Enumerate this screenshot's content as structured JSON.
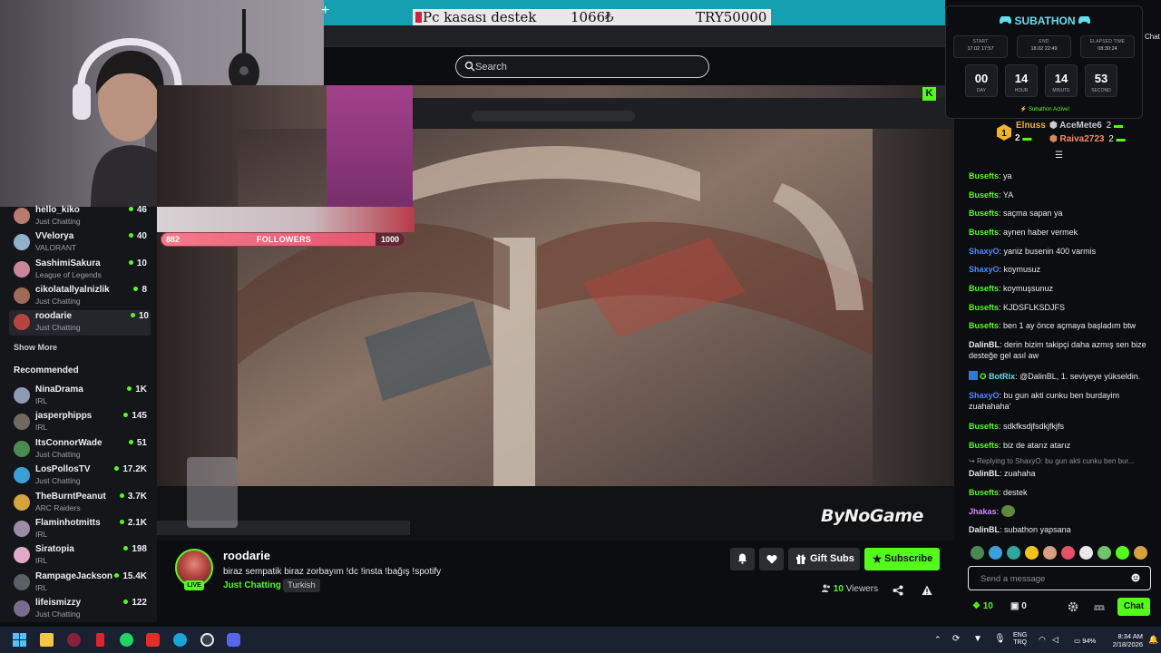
{
  "overlay_banner": {
    "title": "Pc kasası destek",
    "amount": "1066₺",
    "target": "TRY50000"
  },
  "search": {
    "placeholder": "Search"
  },
  "followers_goal": {
    "label": "FOLLOWERS",
    "current": "882",
    "goal": "1000",
    "progress": 0.882
  },
  "sidebar": {
    "following": [
      {
        "name": "hello_kiko",
        "category": "Just Chatting",
        "viewers": "46",
        "avatar_color": "#b87b6e"
      },
      {
        "name": "VVelorya",
        "category": "VALORANT",
        "viewers": "40",
        "avatar_color": "#8fb1c9"
      },
      {
        "name": "SashimiSakura",
        "category": "League of Legends",
        "viewers": "10",
        "avatar_color": "#c9869b"
      },
      {
        "name": "cikolatallyalnizlik",
        "category": "Just Chatting",
        "viewers": "8",
        "avatar_color": "#a06a58"
      },
      {
        "name": "roodarie",
        "category": "Just Chatting",
        "viewers": "10",
        "avatar_color": "#b5443f"
      }
    ],
    "show_more": "Show More",
    "recommended_heading": "Recommended",
    "recommended": [
      {
        "name": "NinaDrama",
        "category": "IRL",
        "viewers": "1K",
        "avatar_color": "#8d9ab5"
      },
      {
        "name": "jasperphipps",
        "category": "IRL",
        "viewers": "145",
        "avatar_color": "#6f6a60"
      },
      {
        "name": "ItsConnorWade",
        "category": "Just Chatting",
        "viewers": "51",
        "avatar_color": "#4a8b52"
      },
      {
        "name": "LosPollosTV",
        "category": "Just Chatting",
        "viewers": "17.2K",
        "avatar_color": "#3aa0d8"
      },
      {
        "name": "TheBurntPeanut",
        "category": "ARC Raiders",
        "viewers": "3.7K",
        "avatar_color": "#d6a43a"
      },
      {
        "name": "Flaminhotmitts",
        "category": "IRL",
        "viewers": "2.1K",
        "avatar_color": "#9d8ca6"
      },
      {
        "name": "Siratopia",
        "category": "IRL",
        "viewers": "198",
        "avatar_color": "#e0a9c8"
      },
      {
        "name": "RampageJackson",
        "category": "IRL",
        "viewers": "15.4K",
        "avatar_color": "#5b5f68"
      },
      {
        "name": "lifeismizzy",
        "category": "Just Chatting",
        "viewers": "122",
        "avatar_color": "#7a6b8d"
      }
    ]
  },
  "stream": {
    "streamer_name": "roodarie",
    "live_label": "LIVE",
    "title": "biraz sempatik biraz zorbayım !dc !insta !bağış !spotify",
    "category": "Just Chatting",
    "language": "Turkish",
    "viewers_number": "10",
    "viewers_label": "Viewers",
    "gift_subs_label": "Gift Subs",
    "subscribe_label": "Subscribe",
    "watermark": "ByNoGame"
  },
  "subathon": {
    "title": "SUBATHON",
    "start_label": "START",
    "start_value": "17.02 17:57",
    "end_label": "END",
    "end_value": "18.02 22:49",
    "elapsed_label": "ELAPSED TIME",
    "elapsed_value": "08:30:24",
    "countdown": [
      {
        "value": "00",
        "unit": "DAY"
      },
      {
        "value": "14",
        "unit": "HOUR"
      },
      {
        "value": "14",
        "unit": "MINUTE"
      },
      {
        "value": "53",
        "unit": "SECOND"
      }
    ],
    "status": "Subathon Active!",
    "chat_tab": "Chat"
  },
  "gifters": {
    "first": {
      "name": "Elnuss",
      "count": "2"
    },
    "second": {
      "name": "AceMete6",
      "count": "2"
    },
    "third": {
      "name": "Raiva2723",
      "count": "2"
    }
  },
  "chat": {
    "messages": [
      {
        "user": "Busefts",
        "user_color": "#53fc18",
        "text": "ya"
      },
      {
        "user": "Busefts",
        "user_color": "#53fc18",
        "text": "YA"
      },
      {
        "user": "Busefts",
        "user_color": "#53fc18",
        "text": "saçma sapan ya"
      },
      {
        "user": "Busefts",
        "user_color": "#53fc18",
        "text": "aynen haber vermek"
      },
      {
        "user": "ShaxyO",
        "user_color": "#4a8cff",
        "text": "yaniz busenin 400 varmis"
      },
      {
        "user": "ShaxyO",
        "user_color": "#4a8cff",
        "text": "koymusuz"
      },
      {
        "user": "Busefts",
        "user_color": "#53fc18",
        "text": "koymuşsunuz"
      },
      {
        "user": "Busefts",
        "user_color": "#53fc18",
        "text": "KJDSFLKSDJFS"
      },
      {
        "user": "Busefts",
        "user_color": "#53fc18",
        "text": "ben 1 ay önce açmaya başladım btw"
      },
      {
        "user": "DalinBL",
        "user_color": "#e9eaec",
        "text": "derin bizim takipçi daha azmış sen bize desteğe gel asıl aw"
      },
      {
        "user": "BotRix",
        "user_color": "#5fe2f0",
        "text": "@DalinBL, 1. seviyeye yükseldin."
      },
      {
        "user": "ShaxyO",
        "user_color": "#4a8cff",
        "text": "bu gun akti cunku ben burdayim zuahahaha'"
      },
      {
        "user": "Busefts",
        "user_color": "#53fc18",
        "text": "sdkfksdjfsdkjfkjfs"
      },
      {
        "user": "Busefts",
        "user_color": "#53fc18",
        "text": "biz de atarız atarız"
      },
      {
        "user": "DalinBL",
        "user_color": "#e9eaec",
        "text": "zuahaha"
      },
      {
        "user": "Busefts",
        "user_color": "#53fc18",
        "text": "destek"
      },
      {
        "user": "Jhakas",
        "user_color": "#c98bff",
        "text": ""
      },
      {
        "user": "DalinBL",
        "user_color": "#e9eaec",
        "text": "subathon yapsana"
      }
    ],
    "reply_reference": "Replying to ShaxyO: bu gun akti cunku ben bur...",
    "input_placeholder": "Send a message",
    "points": "10",
    "subs": "0",
    "send_label": "Chat"
  },
  "taskbar": {
    "lang_top": "ENG",
    "lang_bottom": "TRQ",
    "battery": "94%",
    "time": "8:34 AM",
    "date": "2/18/2026"
  }
}
